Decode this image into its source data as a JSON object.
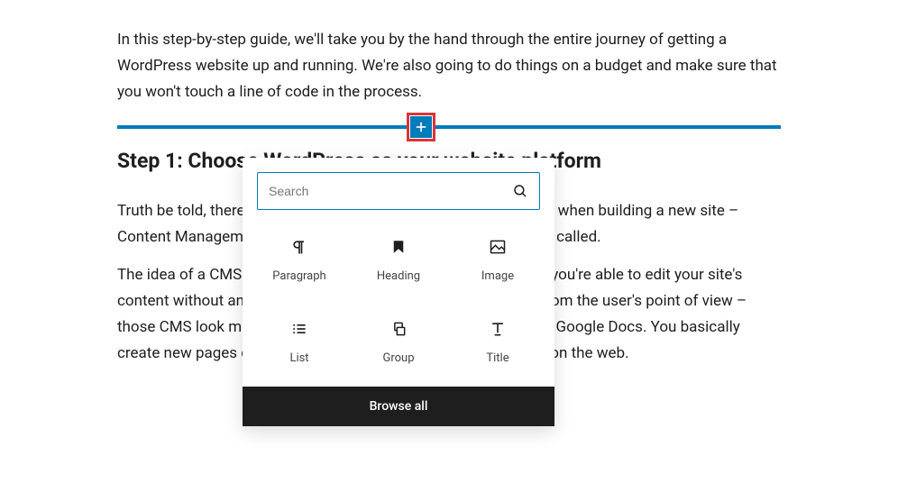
{
  "content": {
    "intro_paragraph": "In this step-by-step guide, we'll take you by the hand through the entire journey of getting a WordPress website up and running. We're also going to do things on a budget and make sure that you won't touch a line of code in the process.",
    "heading": "Step 1: Choose WordPress as your website platform",
    "paragraph_2": "Truth be told, there are many website platforms that you can use when building a new site – Content Management Systems (CMS) is the what they're usually called.",
    "paragraph_3": "The idea of a CMS is to give you some easy-to-use tools so that you're able to edit your site's content without any knowledge of coding. For the most part – from the user's point of view – those CMS look much like the familiar interfaces at Facebook or Google Docs. You basically create new pages or documents, and then have them published on the web."
  },
  "inserter": {
    "search_placeholder": "Search",
    "blocks": [
      {
        "label": "Paragraph",
        "icon": "paragraph"
      },
      {
        "label": "Heading",
        "icon": "heading"
      },
      {
        "label": "Image",
        "icon": "image"
      },
      {
        "label": "List",
        "icon": "list"
      },
      {
        "label": "Group",
        "icon": "group"
      },
      {
        "label": "Title",
        "icon": "title"
      }
    ],
    "browse_all_label": "Browse all"
  }
}
